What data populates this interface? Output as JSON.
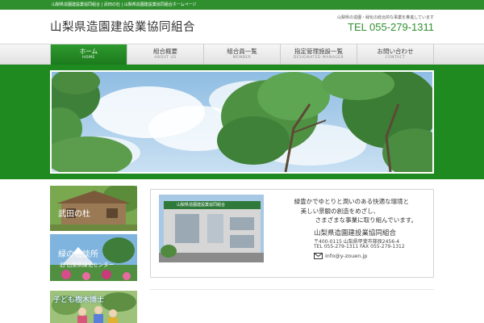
{
  "topbar": {
    "text": "山梨県造園建設業協同組合 | 武田の杜 | 山梨県造園建設業協同組合ホームページ"
  },
  "header": {
    "title": "山梨県造園建設業協同組合",
    "description": "山梨県の造園・緑化の総合的な事業を推進しています",
    "tel": "TEL 055-279-1311"
  },
  "nav": {
    "items": [
      {
        "ja": "ホーム",
        "en": "HOME"
      },
      {
        "ja": "組合概要",
        "en": "ABOUT US"
      },
      {
        "ja": "組合員一覧",
        "en": "MEMBER"
      },
      {
        "ja": "指定管理施設一覧",
        "en": "DESIGNATED MANAGER"
      },
      {
        "ja": "お問い合わせ",
        "en": "CONTACT"
      }
    ]
  },
  "banners": {
    "takeda": "武田の杜",
    "soudan_title": "緑の相談所",
    "soudan_sub": "旧 山梨県緑化センター",
    "kodomo": "子ども樹木博士"
  },
  "intro": {
    "line1": "緑豊かでゆとりと潤いのある快適な環境と",
    "line2": "美しい景観の創造をめざし、",
    "line3": "さまざまな事業に取り組んでいます。",
    "org_name": "山梨県造園建設業協同組合",
    "address": "〒400-0115 山梨県甲斐市篠原2456-4",
    "tel_fax": "TEL 055-279-1311 FAX 055-279-1312",
    "email": "info@y-zouen.jp",
    "building_sign": "山梨県造園建設業協同組合"
  },
  "colors": {
    "brand_green": "#2f8f2f",
    "hero_green": "#1f8a1f",
    "sky_blue": "#a9cdea"
  }
}
